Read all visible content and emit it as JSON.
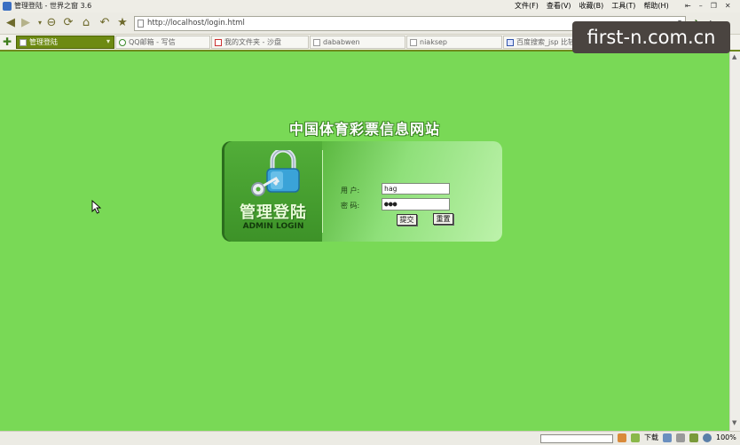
{
  "window": {
    "title": "管理登陆 - 世界之窗 3.6",
    "menus": [
      "文件(F)",
      "查看(V)",
      "收藏(B)",
      "工具(T)",
      "帮助(H)"
    ],
    "controls": [
      "⇤",
      "–",
      "❐",
      "✕"
    ]
  },
  "nav": {
    "address": "http://localhost/login.html"
  },
  "tabs": [
    {
      "label": "管理登陆",
      "active": true
    },
    {
      "label": "QQ邮箱 - 写信",
      "active": false
    },
    {
      "label": "我的文件夹 - 沙盘",
      "active": false
    },
    {
      "label": "dababwen",
      "active": false
    },
    {
      "label": "niaksep",
      "active": false
    },
    {
      "label": "百度搜索_jsp 比较",
      "active": false
    }
  ],
  "page": {
    "site_title": "中国体育彩票信息网站",
    "admin_title": "管理登陆",
    "admin_subtitle": "ADMIN LOGIN",
    "username_label": "用  户:",
    "password_label": "密  码:",
    "username_value": "hag",
    "password_value": "●●●",
    "submit_label": "提交",
    "reset_label": "重置"
  },
  "status": {
    "download_label": "下载",
    "zoom": "100%"
  },
  "watermark": "first-n.com.cn",
  "colors": {
    "page_bg": "#79d956",
    "tab_active": "#6d8a12"
  }
}
